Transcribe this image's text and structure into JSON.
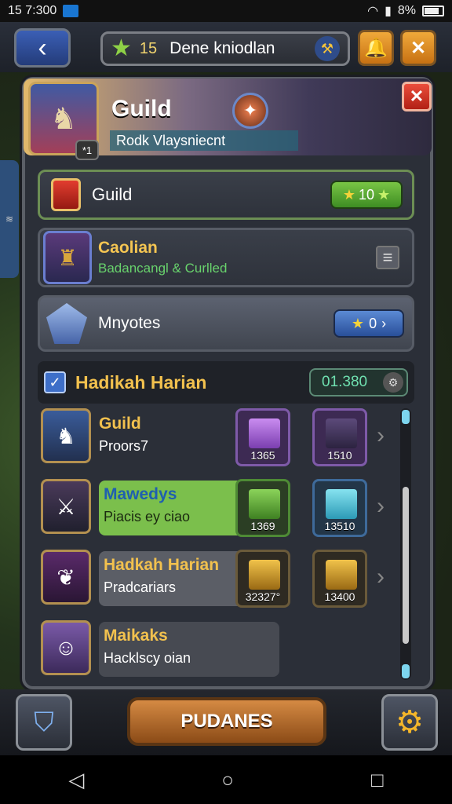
{
  "status": {
    "time": "15 7:300",
    "battery": "8%"
  },
  "top": {
    "level": "15",
    "title": "Dene kniodlan"
  },
  "hero": {
    "title": "Guild",
    "subtitle": "Rodk Vlaysniecnt",
    "level": "*1"
  },
  "row1": {
    "label": "Guild",
    "value": "10"
  },
  "row2": {
    "name": "Caolian",
    "sub": "Badancangl & Curlled"
  },
  "row3": {
    "label": "Mnyotes",
    "value": "0"
  },
  "section": {
    "label": "Hadikah Harian",
    "counter": "01.380"
  },
  "list": [
    {
      "name": "Guild",
      "sub": "Proors7",
      "r1": "1365",
      "r2": "1510"
    },
    {
      "name": "Mawedys",
      "sub": "Piacis ey ciao",
      "r1": "1369",
      "r2": "13510"
    },
    {
      "name": "Hadkah Harian",
      "sub": "Pradcariars",
      "r1": "32327°",
      "r2": "13400"
    },
    {
      "name": "Maikaks",
      "sub": "Hacklscy oian"
    }
  ],
  "main_button": "PUDANES"
}
